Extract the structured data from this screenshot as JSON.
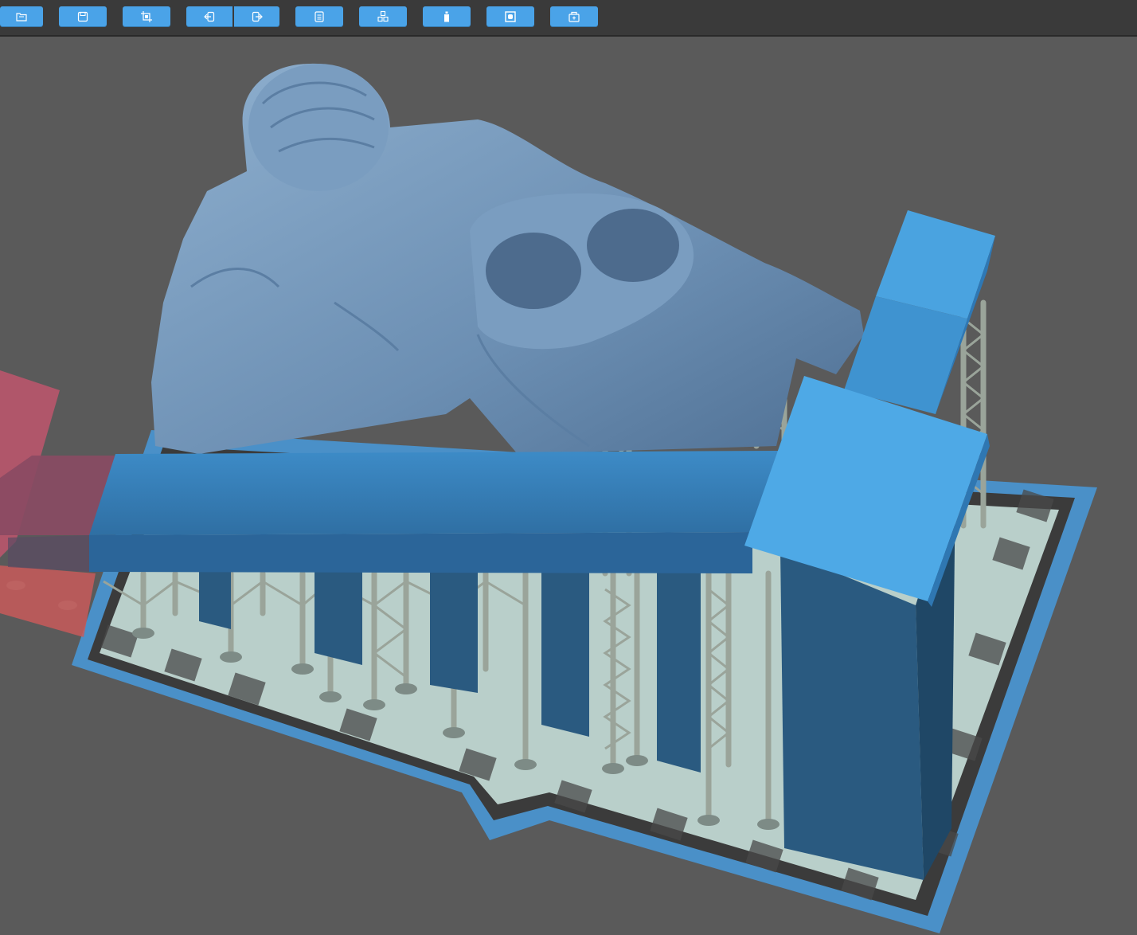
{
  "toolbar": {
    "buttons": [
      {
        "id": "open",
        "icon": "folder-open-icon"
      },
      {
        "id": "save",
        "icon": "save-disk-icon"
      },
      {
        "id": "crop",
        "icon": "crop-icon"
      },
      {
        "id": "import",
        "icon": "import-arrow-icon"
      },
      {
        "id": "export",
        "icon": "export-arrow-icon"
      },
      {
        "id": "document",
        "icon": "document-icon"
      },
      {
        "id": "arrange",
        "icon": "cubes-arrange-icon"
      },
      {
        "id": "resin",
        "icon": "bottle-icon"
      },
      {
        "id": "hollow",
        "icon": "hollow-square-icon"
      },
      {
        "id": "slice-export",
        "icon": "printer-icon"
      }
    ],
    "accent": "#4aa3e8"
  },
  "viewport": {
    "colors": {
      "background": "#5a5a5a",
      "plate_border": "#4a90c8",
      "plate_fill": "#b8cfca",
      "model": "#6f93b8",
      "supports": "#9aa49a",
      "object_selected": "#4aa9e6",
      "object_dark": "#2a5a80",
      "out_of_bounds": "#b0566a"
    }
  }
}
